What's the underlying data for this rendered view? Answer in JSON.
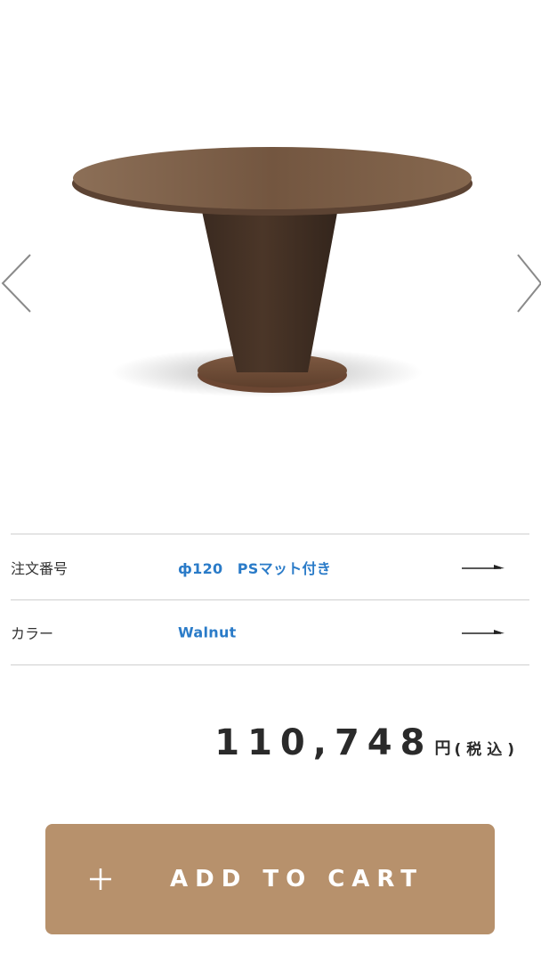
{
  "gallery": {
    "product_image": "round-pedestal-table",
    "prev_icon": "chevron-left-icon",
    "next_icon": "chevron-right-icon"
  },
  "options": [
    {
      "label": "注文番号",
      "value": "ф120　PSマット付き",
      "icon": "arrow-right-icon"
    },
    {
      "label": "カラー",
      "value": "Walnut",
      "icon": "arrow-right-icon"
    }
  ],
  "price": {
    "amount": "110,748",
    "unit": "円",
    "tax_note": "(税込)"
  },
  "cart": {
    "icon": "plus-icon",
    "label": "ADD TO CART"
  },
  "colors": {
    "accent_link": "#2a7bc8",
    "cart_button": "#b7916c"
  }
}
